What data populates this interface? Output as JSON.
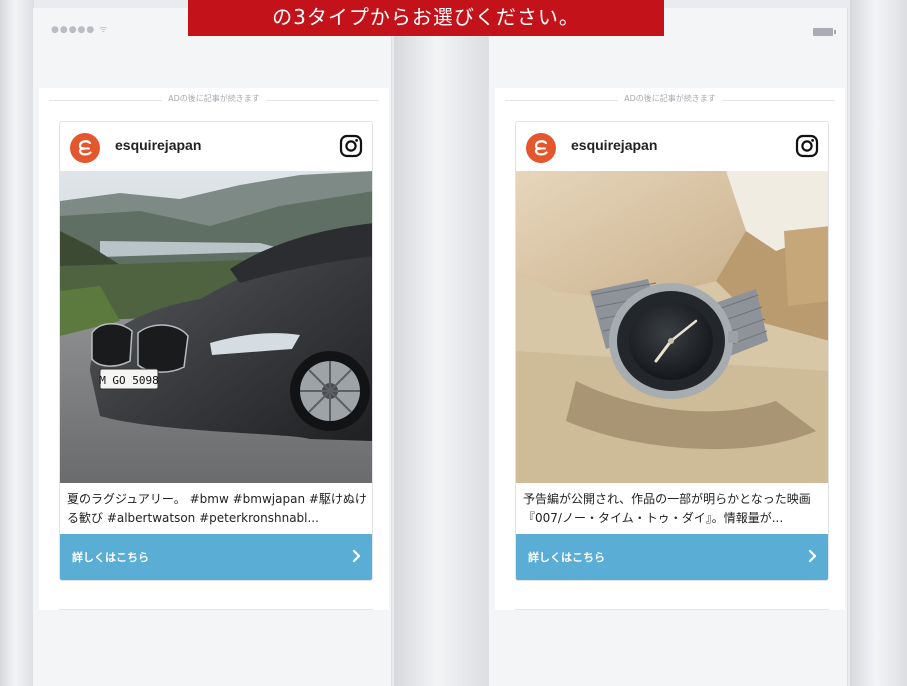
{
  "banner": {
    "text": "の3タイプからお選びください。"
  },
  "phones": [
    {
      "status": {
        "signal": "●●●●● ᯤ"
      },
      "ad_notice": "ADの後に記事が続きます",
      "card": {
        "username": "esquirejapan",
        "caption": "夏のラグジュアリー。 #bmw #bmwjapan #駆けぬける歓び #albertwatson #peterkronshnabl...",
        "cta_label": "詳しくはこちら",
        "photo": "car-photo",
        "license_plate": "M GO 5098"
      }
    },
    {
      "status": {
        "battery": "battery-icon"
      },
      "ad_notice": "ADの後に記事が続きます",
      "card": {
        "username": "esquirejapan",
        "caption": "予告編が公開され、作品の一部が明らかとなった映画『007/ノー・タイム・トゥ・ダイ』。情報量が...",
        "cta_label": "詳しくはこちら",
        "photo": "watch-photo"
      }
    }
  ],
  "colors": {
    "banner": "#c3121a",
    "cta": "#5aaed6",
    "avatar": "#e4572e",
    "background": "#e9ebef"
  }
}
